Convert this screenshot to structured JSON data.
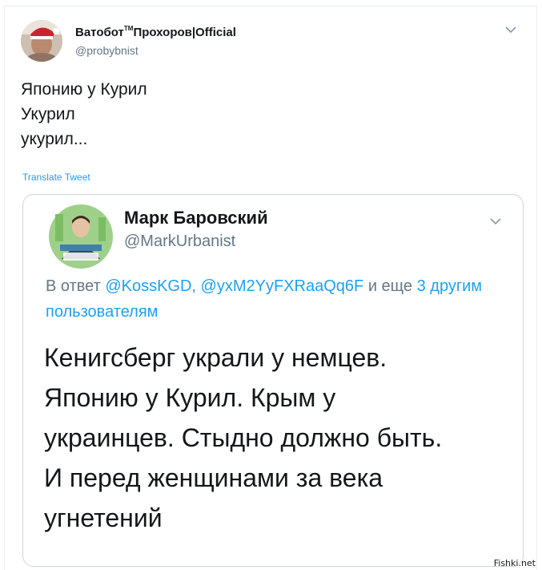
{
  "tweet": {
    "author_name": "Ватобот",
    "author_tm": "TM",
    "author_name_rest": "Прохоров|Official",
    "author_handle": "@probybnist",
    "text_lines": [
      "Японию у Курил",
      "Укурил",
      "укурил..."
    ],
    "translate_label": "Translate Tweet",
    "menu_icon": "chevron-down-icon"
  },
  "quoted": {
    "author_name": "Марк Баровский",
    "author_handle": "@MarkUrbanist",
    "reply_prefix": "В ответ",
    "reply_mentions": "@KossKGD, @yxM2YyFXRaaQq6F",
    "reply_and": "и еще",
    "reply_others": "3 другим пользователям",
    "text_lines": [
      "Кенигсберг украли у немцев.",
      "Японию у Курил. Крым у",
      "украинцев. Стыдно должно быть.",
      "И перед женщинами за века",
      "угнетений"
    ],
    "menu_icon": "chevron-down-icon"
  },
  "watermark": "Fishki.net",
  "colors": {
    "link": "#1da1f2",
    "secondary_text": "#657786",
    "border": "#ccd6dd"
  }
}
